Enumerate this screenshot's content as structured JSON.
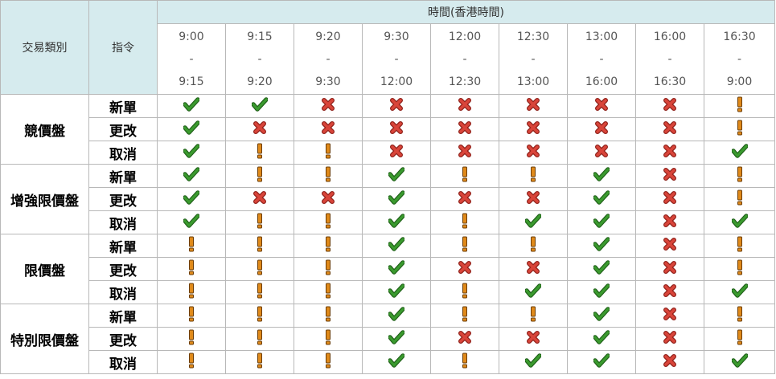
{
  "header": {
    "category_label": "交易類別",
    "command_label": "指令",
    "time_title": "時間(香港時間)",
    "time_slots": [
      {
        "start": "9:00",
        "sep": "-",
        "end": "9:15"
      },
      {
        "start": "9:15",
        "sep": "-",
        "end": "9:20"
      },
      {
        "start": "9:20",
        "sep": "-",
        "end": "9:30"
      },
      {
        "start": "9:30",
        "sep": "-",
        "end": "12:00"
      },
      {
        "start": "12:00",
        "sep": "-",
        "end": "12:30"
      },
      {
        "start": "12:30",
        "sep": "-",
        "end": "13:00"
      },
      {
        "start": "13:00",
        "sep": "-",
        "end": "16:00"
      },
      {
        "start": "16:00",
        "sep": "-",
        "end": "16:30"
      },
      {
        "start": "16:30",
        "sep": "-",
        "end": "9:00"
      }
    ]
  },
  "icons": {
    "allowed": "check-icon",
    "not_allowed": "cross-icon",
    "conditional": "exclamation-icon"
  },
  "colors": {
    "header_bg": "#d6ebee",
    "check": "#3a9a2e",
    "cross": "#d9453a",
    "exclaim": "#e08a1a"
  },
  "groups": [
    {
      "category": "競價盤",
      "rows": [
        {
          "command": "新單",
          "status": [
            "Y",
            "Y",
            "X",
            "X",
            "X",
            "X",
            "X",
            "X",
            "!"
          ]
        },
        {
          "command": "更改",
          "status": [
            "Y",
            "X",
            "X",
            "X",
            "X",
            "X",
            "X",
            "X",
            "!"
          ]
        },
        {
          "command": "取消",
          "status": [
            "Y",
            "!",
            "!",
            "X",
            "X",
            "X",
            "X",
            "X",
            "Y"
          ]
        }
      ]
    },
    {
      "category": "增強限價盤",
      "rows": [
        {
          "command": "新單",
          "status": [
            "Y",
            "!",
            "!",
            "Y",
            "!",
            "!",
            "Y",
            "X",
            "!"
          ]
        },
        {
          "command": "更改",
          "status": [
            "Y",
            "X",
            "X",
            "Y",
            "X",
            "X",
            "Y",
            "X",
            "!"
          ]
        },
        {
          "command": "取消",
          "status": [
            "Y",
            "!",
            "!",
            "Y",
            "!",
            "Y",
            "Y",
            "X",
            "Y"
          ]
        }
      ]
    },
    {
      "category": "限價盤",
      "rows": [
        {
          "command": "新單",
          "status": [
            "!",
            "!",
            "!",
            "Y",
            "!",
            "!",
            "Y",
            "X",
            "!"
          ]
        },
        {
          "command": "更改",
          "status": [
            "!",
            "!",
            "!",
            "Y",
            "X",
            "X",
            "Y",
            "X",
            "!"
          ]
        },
        {
          "command": "取消",
          "status": [
            "!",
            "!",
            "!",
            "Y",
            "!",
            "Y",
            "Y",
            "X",
            "Y"
          ]
        }
      ]
    },
    {
      "category": "特別限價盤",
      "rows": [
        {
          "command": "新單",
          "status": [
            "!",
            "!",
            "!",
            "Y",
            "!",
            "!",
            "Y",
            "X",
            "!"
          ]
        },
        {
          "command": "更改",
          "status": [
            "!",
            "!",
            "!",
            "Y",
            "X",
            "X",
            "Y",
            "X",
            "!"
          ]
        },
        {
          "command": "取消",
          "status": [
            "!",
            "!",
            "!",
            "Y",
            "!",
            "Y",
            "Y",
            "X",
            "Y"
          ]
        }
      ]
    }
  ]
}
